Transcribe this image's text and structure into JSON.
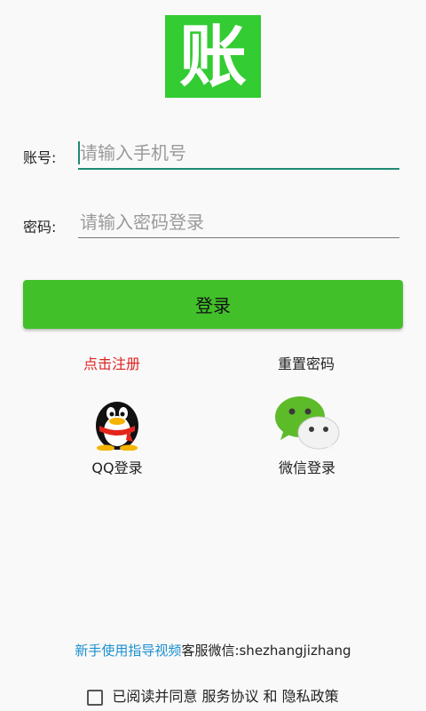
{
  "logo": {
    "char": "账",
    "bg_color": "#33cc33"
  },
  "account": {
    "label": "账号:",
    "placeholder": "请输入手机号"
  },
  "password": {
    "label": "密码:",
    "placeholder": "请输入密码登录"
  },
  "login_button": {
    "label": "登录",
    "color": "#42c02a"
  },
  "links": {
    "register": "点击注册",
    "reset_password": "重置密码"
  },
  "social": {
    "qq": {
      "label": "QQ登录",
      "icon": "qq-penguin-icon"
    },
    "wechat": {
      "label": "微信登录",
      "icon": "wechat-icon"
    }
  },
  "help": {
    "guide_link": "新手使用指导视频",
    "service_text": "客服微信:shezhangjizhang"
  },
  "agreement": {
    "prefix": "已阅读并同意",
    "service_link": "服务协议",
    "and": "和",
    "privacy_link": "隐私政策",
    "checked": false
  },
  "colors": {
    "accent": "#1f8a73",
    "link_red": "#e02020",
    "link_blue": "#1a8fd0"
  }
}
